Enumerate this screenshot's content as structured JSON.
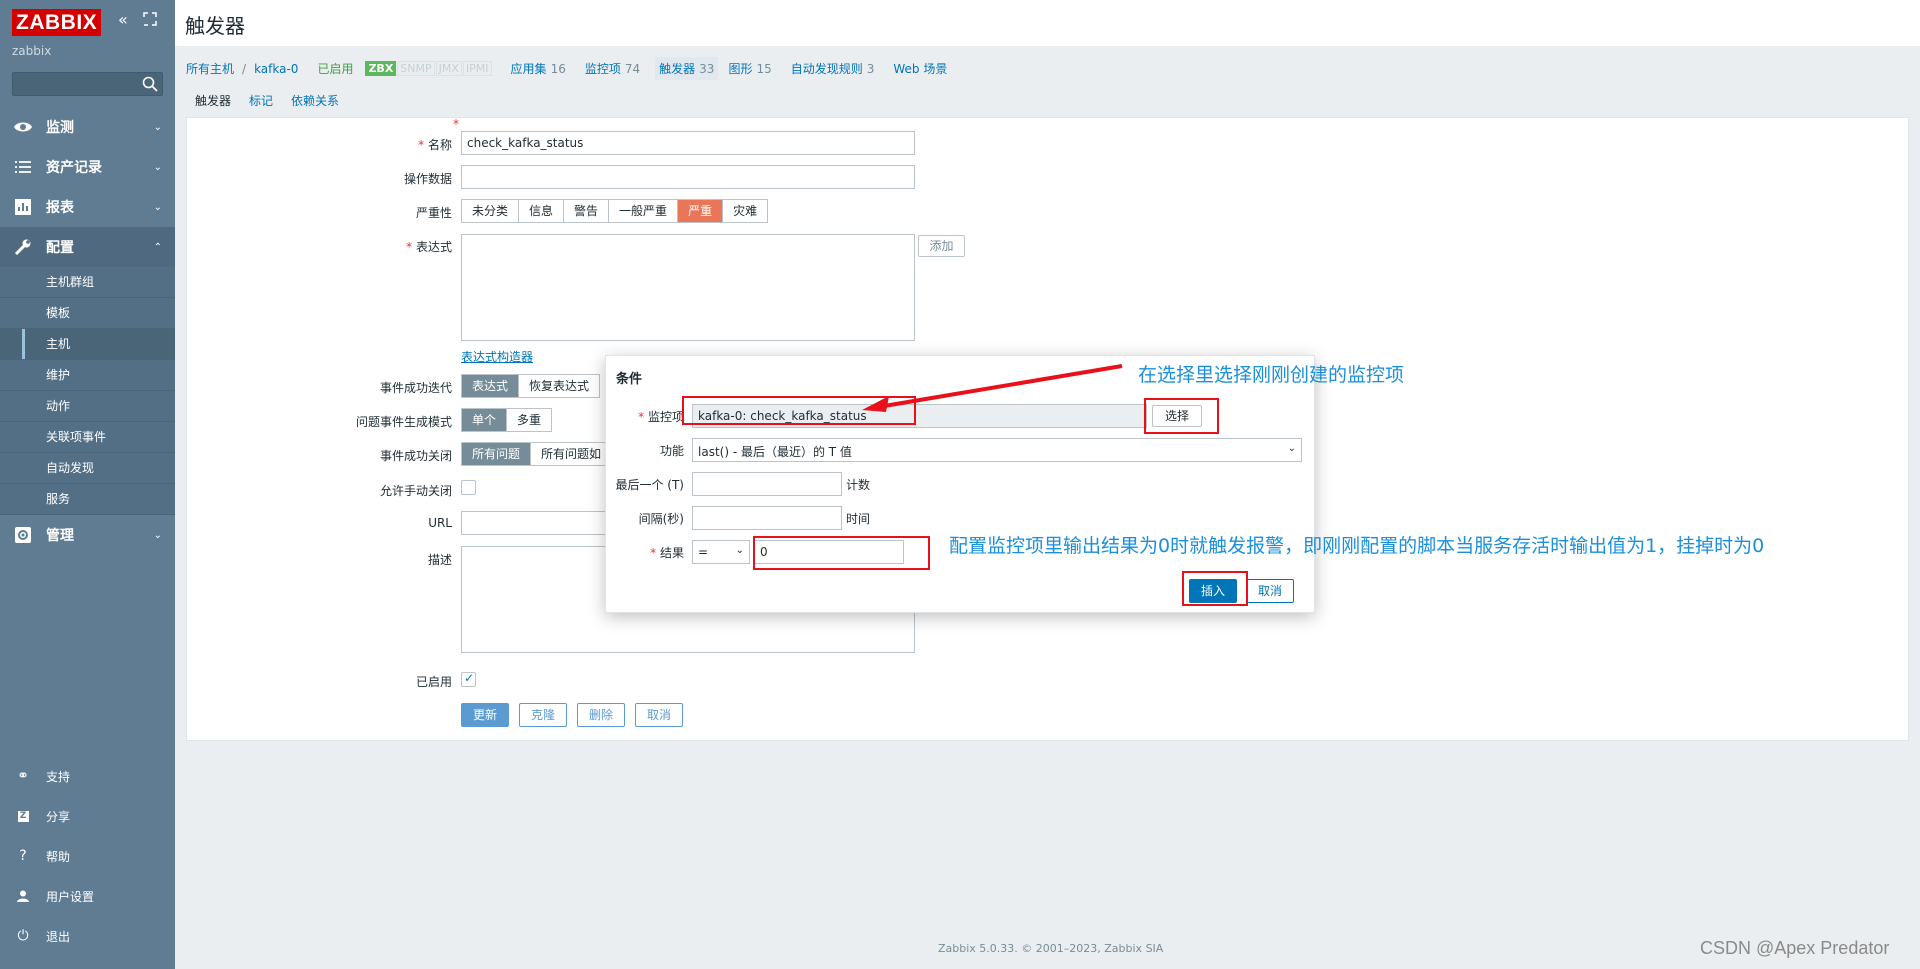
{
  "sidebar": {
    "logo": "ZABBIX",
    "server_name": "zabbix",
    "search_placeholder": "",
    "menu": [
      {
        "label": "监测",
        "icon": "eye-icon"
      },
      {
        "label": "资产记录",
        "icon": "list-icon"
      },
      {
        "label": "报表",
        "icon": "bar-chart-icon"
      },
      {
        "label": "配置",
        "icon": "wrench-icon"
      },
      {
        "label": "管理",
        "icon": "gear-icon"
      }
    ],
    "config_submenu": [
      "主机群组",
      "模板",
      "主机",
      "维护",
      "动作",
      "关联项事件",
      "自动发现",
      "服务"
    ],
    "bottom": [
      {
        "label": "支持",
        "icon": "headset-icon"
      },
      {
        "label": "分享",
        "icon": "share-icon"
      },
      {
        "label": "帮助",
        "icon": "help-icon"
      },
      {
        "label": "用户设置",
        "icon": "user-icon"
      },
      {
        "label": "退出",
        "icon": "power-icon"
      }
    ]
  },
  "page": {
    "title": "触发器"
  },
  "host_nav": {
    "all_hosts": "所有主机",
    "separator": "/",
    "host": "kafka-0",
    "status": "已启用",
    "zbx": "ZBX",
    "snmp": "SNMP",
    "jmx": "JMX",
    "ipmi": "IPMI",
    "applications": "应用集",
    "applications_count": "16",
    "items": "监控项",
    "items_count": "74",
    "triggers": "触发器",
    "triggers_count": "33",
    "graphs": "图形",
    "graphs_count": "15",
    "discovery": "自动发现规则",
    "discovery_count": "3",
    "web": "Web 场景"
  },
  "tabs": [
    "触发器",
    "标记",
    "依赖关系"
  ],
  "form": {
    "name_label": "名称",
    "name_value": "check_kafka_status",
    "opdata_label": "操作数据",
    "opdata_value": "",
    "severity_label": "严重性",
    "severities": [
      "未分类",
      "信息",
      "警告",
      "一般严重",
      "严重",
      "灾难"
    ],
    "expression_label": "表达式",
    "add_button": "添加",
    "expr_builder_link": "表达式构造器",
    "ok_event_label": "事件成功迭代",
    "ok_event_options": [
      "表达式",
      "恢复表达式"
    ],
    "problem_mode_label": "问题事件生成模式",
    "problem_mode_options": [
      "单个",
      "多重"
    ],
    "ok_close_label": "事件成功关闭",
    "ok_close_options": [
      "所有问题",
      "所有问题如"
    ],
    "manual_close_label": "允许手动关闭",
    "url_label": "URL",
    "desc_label": "描述",
    "enabled_label": "已启用",
    "buttons": {
      "update": "更新",
      "clone": "克隆",
      "delete": "删除",
      "cancel": "取消"
    }
  },
  "modal": {
    "title": "条件",
    "item_label": "监控项",
    "item_value": "kafka-0: check_kafka_status",
    "select_button": "选择",
    "function_label": "功能",
    "function_value": "last() - 最后（最近）的 T 值",
    "last_label": "最后一个 (T)",
    "last_unit": "计数",
    "interval_label": "间隔(秒)",
    "interval_unit": "时间",
    "result_label": "结果",
    "operator": "=",
    "result_value": "0",
    "insert_button": "插入",
    "cancel_button": "取消"
  },
  "annotations": {
    "select_hint": "在选择里选择刚刚创建的监控项",
    "result_hint": "配置监控项里输出结果为0时就触发报警，即刚刚配置的脚本当服务存活时输出值为1，挂掉时为0"
  },
  "footer": "Zabbix 5.0.33. © 2001–2023, Zabbix SIA",
  "watermark": "CSDN @Apex    Predator",
  "colors": {
    "sidebar": "#5f7c93",
    "accent": "#0275b8",
    "annotation": "#1a8fdd",
    "annotation_box": "#e8101a",
    "severity_high": "#e97659"
  }
}
